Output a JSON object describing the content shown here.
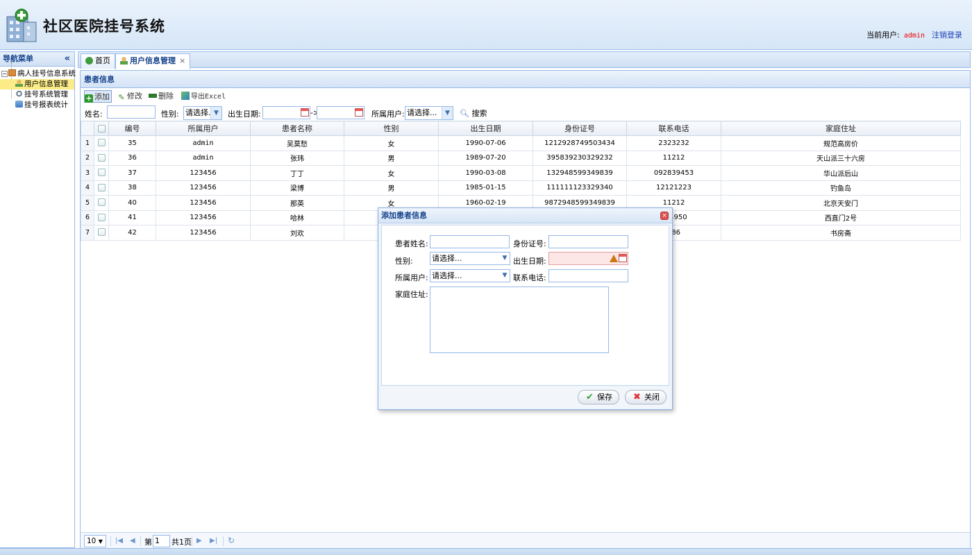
{
  "header": {
    "title": "社区医院挂号系统",
    "current_user_label": "当前用户:",
    "current_user": "admin",
    "logout": "注销登录"
  },
  "sidebar": {
    "title": "导航菜单",
    "collapse_glyph": "«",
    "root": {
      "label": "病人挂号信息系统",
      "toggle": "−"
    },
    "items": [
      {
        "label": "用户信息管理",
        "selected": true
      },
      {
        "label": "挂号系统管理",
        "selected": false
      },
      {
        "label": "挂号报表统计",
        "selected": false
      }
    ]
  },
  "tabs": [
    {
      "label": "首页",
      "closable": false,
      "active": false
    },
    {
      "label": "用户信息管理",
      "closable": true,
      "active": true,
      "close_glyph": "×"
    }
  ],
  "panel": {
    "title": "患者信息"
  },
  "toolbar": {
    "add": "添加",
    "edit": "修改",
    "delete": "删除",
    "export": "导出Excel"
  },
  "search": {
    "name_label": "姓名:",
    "name_value": "",
    "gender_label": "性别:",
    "gender_value": "请选择...",
    "birth_label": "出生日期:",
    "birth_from": "",
    "range_sep": "->",
    "birth_to": "",
    "owner_label": "所属用户:",
    "owner_value": "请选择...",
    "search_button": "搜索"
  },
  "grid": {
    "columns": [
      "编号",
      "所属用户",
      "患者名称",
      "性别",
      "出生日期",
      "身份证号",
      "联系电话",
      "家庭住址"
    ],
    "rows": [
      {
        "rn": "1",
        "id": "35",
        "owner": "admin",
        "name": "吴莫愁",
        "gender": "女",
        "birth": "1990-07-06",
        "idcard": "1212928749503434",
        "phone": "2323232",
        "address": "规范高房价"
      },
      {
        "rn": "2",
        "id": "36",
        "owner": "admin",
        "name": "张玮",
        "gender": "男",
        "birth": "1989-07-20",
        "idcard": "395839230329232",
        "phone": "11212",
        "address": "天山派三十六房"
      },
      {
        "rn": "3",
        "id": "37",
        "owner": "123456",
        "name": "丁丁",
        "gender": "女",
        "birth": "1990-03-08",
        "idcard": "132948599349839",
        "phone": "092839453",
        "address": "华山派后山"
      },
      {
        "rn": "4",
        "id": "38",
        "owner": "123456",
        "name": "梁博",
        "gender": "男",
        "birth": "1985-01-15",
        "idcard": "111111123329340",
        "phone": "12121223",
        "address": "钓鱼岛"
      },
      {
        "rn": "5",
        "id": "40",
        "owner": "123456",
        "name": "那英",
        "gender": "女",
        "birth": "1960-02-19",
        "idcard": "9872948599349839",
        "phone": "11212",
        "address": "北京天安门"
      },
      {
        "rn": "6",
        "id": "41",
        "owner": "123456",
        "name": "哈林",
        "gender": "",
        "birth": "",
        "idcard": "",
        "phone": "394950",
        "address": "西直门2号"
      },
      {
        "rn": "7",
        "id": "42",
        "owner": "123456",
        "name": "刘欢",
        "gender": "",
        "birth": "",
        "idcard": "",
        "phone": "086",
        "address": "书房斋"
      }
    ]
  },
  "pager": {
    "page_size": "10",
    "page_prefix": "第",
    "page_value": "1",
    "page_suffix": "共1页"
  },
  "dialog": {
    "title": "添加患者信息",
    "close_glyph": "×",
    "fields": {
      "name_label": "患者姓名:",
      "idcard_label": "身份证号:",
      "gender_label": "性别:",
      "gender_value": "请选择...",
      "birth_label": "出生日期:",
      "owner_label": "所属用户:",
      "owner_value": "请选择...",
      "phone_label": "联系电话:",
      "address_label": "家庭住址:"
    },
    "save": "保存",
    "close": "关闭"
  },
  "colors": {
    "accent": "#15428b",
    "border": "#99bbe8",
    "selected_row": "#fbec88",
    "username": "#ee0000",
    "error_field": "#fde6e6"
  }
}
